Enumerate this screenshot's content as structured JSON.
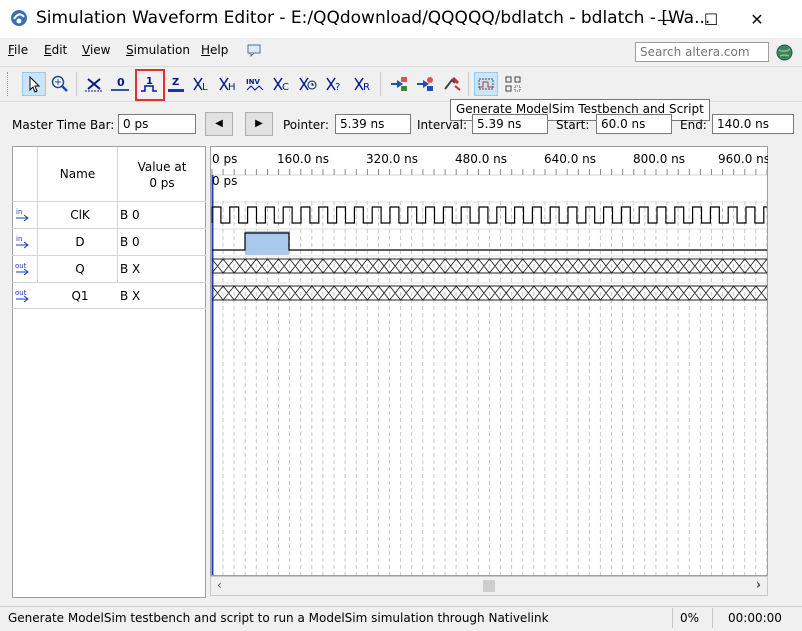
{
  "window": {
    "title": "Simulation Waveform Editor - E:/QQdownload/QQQQQ/bdlatch - bdlatch - [Wa...",
    "minimize": "—",
    "maximize": "☐",
    "close": "✕"
  },
  "menu": {
    "items": [
      {
        "label": "File",
        "accel": "F",
        "rest": "ile"
      },
      {
        "label": "Edit",
        "accel": "E",
        "rest": "dit"
      },
      {
        "label": "View",
        "accel": "V",
        "rest": "iew"
      },
      {
        "label": "Simulation",
        "accel": "S",
        "rest": "imulation"
      },
      {
        "label": "Help",
        "accel": "H",
        "rest": "elp"
      }
    ],
    "search_placeholder": "Search altera.com"
  },
  "toolbar": {
    "tooltip": "Generate ModelSim Testbench and Script",
    "tools": [
      {
        "id": "selection-tool",
        "glyph": "",
        "active": true
      },
      {
        "id": "zoom-tool",
        "glyph": ""
      },
      {
        "id": "forcing-unknown",
        "glyph": "X"
      },
      {
        "id": "forcing-low",
        "glyph": "0"
      },
      {
        "id": "forcing-high",
        "glyph": "1"
      },
      {
        "id": "high-impedance",
        "glyph": "Z"
      },
      {
        "id": "weak-low",
        "glyph": "XL"
      },
      {
        "id": "weak-high",
        "glyph": "XH"
      },
      {
        "id": "invert",
        "glyph": "INV"
      },
      {
        "id": "count-value",
        "glyph": "XC"
      },
      {
        "id": "overwrite-clock",
        "glyph": "X"
      },
      {
        "id": "random-values",
        "glyph": "X?"
      },
      {
        "id": "overwrite-value",
        "glyph": "XR"
      },
      {
        "id": "functional-simulation",
        "glyph": ""
      },
      {
        "id": "timing-simulation",
        "glyph": ""
      },
      {
        "id": "generate-testbench",
        "glyph": ""
      },
      {
        "id": "snap-to-grid",
        "glyph": ""
      },
      {
        "id": "group-nodes",
        "glyph": ""
      }
    ]
  },
  "timebar": {
    "master_label": "Master Time Bar:",
    "master_value": "0 ps",
    "prev": "◀",
    "next": "▶",
    "pointer_label": "Pointer:",
    "pointer_value": "5.39 ns",
    "interval_label": "Interval:",
    "interval_value": "5.39 ns",
    "start_label": "Start:",
    "start_value": "60.0 ns",
    "end_label": "End:",
    "end_value": "140.0 ns"
  },
  "signals": {
    "header_name": "Name",
    "header_value_1": "Value at",
    "header_value_2": "0 ps",
    "rows": [
      {
        "dir": "in",
        "name": "ClK",
        "value": "B 0"
      },
      {
        "dir": "in",
        "name": "D",
        "value": "B 0"
      },
      {
        "dir": "out",
        "name": "Q",
        "value": "B X"
      },
      {
        "dir": "out",
        "name": "Q1",
        "value": "B X"
      }
    ]
  },
  "waveform": {
    "ticks": [
      "0 ps",
      "160.0 ns",
      "320.0 ns",
      "480.0 ns",
      "640.0 ns",
      "800.0 ns",
      "960.0 ns"
    ],
    "cursor_label": "0 ps"
  },
  "status": {
    "message": "Generate ModelSim testbench and script to run a ModelSim simulation through Nativelink",
    "percent": "0%",
    "time": "00:00:00"
  },
  "colors": {
    "highlight": "#e03030",
    "selection_fill": "#a8c8ec",
    "cursor": "#2040c0"
  }
}
